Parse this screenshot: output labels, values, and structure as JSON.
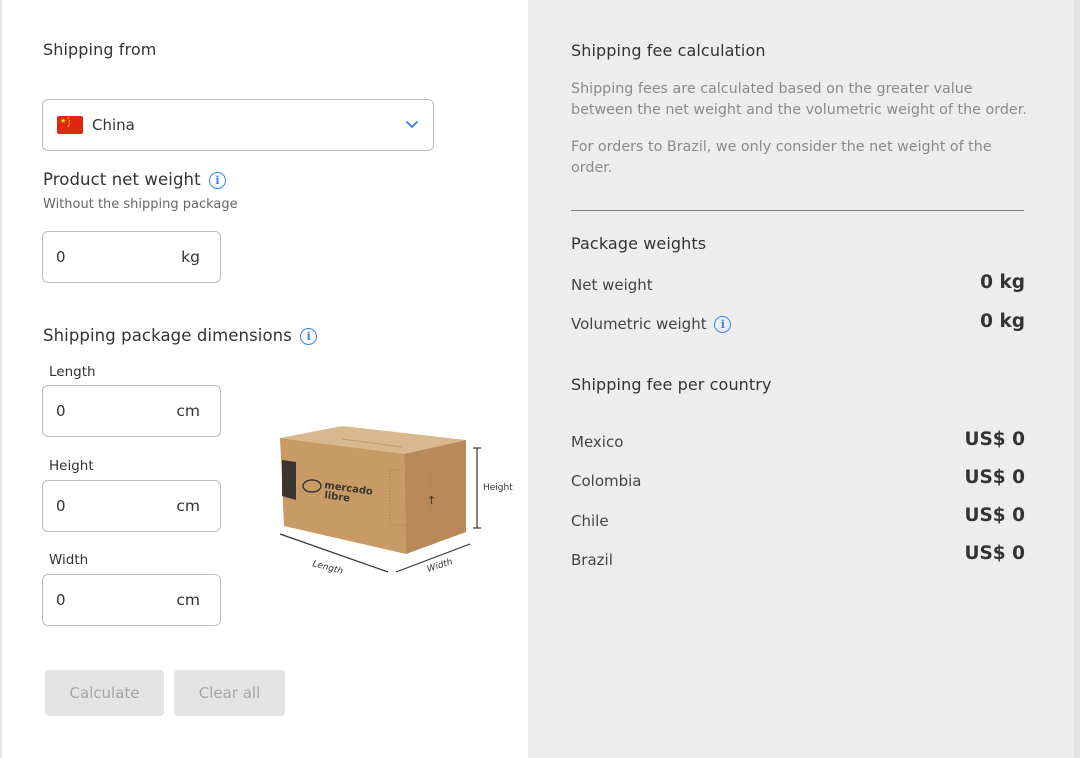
{
  "left": {
    "shipping_from_label": "Shipping from",
    "country": {
      "value": "China",
      "flag": "china-flag"
    },
    "net_weight": {
      "label": "Product net weight",
      "hint": "Without the shipping package",
      "value": "0",
      "unit": "kg"
    },
    "dimensions": {
      "label": "Shipping package dimensions",
      "length": {
        "label": "Length",
        "value": "0",
        "unit": "cm"
      },
      "height": {
        "label": "Height",
        "value": "0",
        "unit": "cm"
      },
      "width": {
        "label": "Width",
        "value": "0",
        "unit": "cm"
      },
      "illustration": {
        "height_label": "Height",
        "length_label": "Length",
        "width_label": "Width",
        "brand_line1": "mercado",
        "brand_line2": "libre"
      }
    },
    "buttons": {
      "calculate": "Calculate",
      "clear": "Clear all"
    }
  },
  "right": {
    "title": "Shipping fee calculation",
    "para1": "Shipping fees are calculated based on the greater value between the net weight and the volumetric weight of the order.",
    "para2": "For orders to Brazil, we only consider the net weight of the order.",
    "package_weights": {
      "title": "Package weights",
      "net_label": "Net weight",
      "net_value": "0 kg",
      "vol_label": "Volumetric weight",
      "vol_value": "0 kg"
    },
    "fees": {
      "title": "Shipping fee per country",
      "countries": [
        {
          "name": "Mexico",
          "fee": "US$ 0"
        },
        {
          "name": "Colombia",
          "fee": "US$ 0"
        },
        {
          "name": "Chile",
          "fee": "US$ 0"
        },
        {
          "name": "Brazil",
          "fee": "US$ 0"
        }
      ]
    }
  },
  "colors": {
    "accent": "#3483fa",
    "panel": "#ededed",
    "disabled_btn": "#e4e4e4"
  }
}
